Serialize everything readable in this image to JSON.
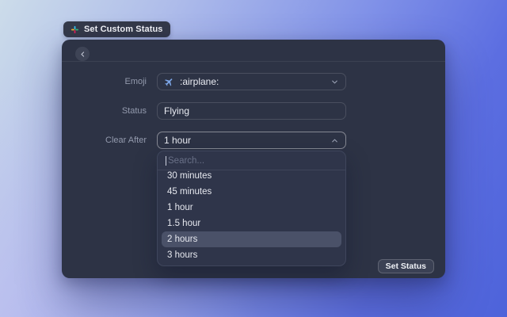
{
  "toast": {
    "label": "Set Custom Status",
    "icon": "slack-icon"
  },
  "window": {
    "header": {
      "back_icon": "chevron-left"
    },
    "form": {
      "emoji_label": "Emoji",
      "emoji_value": ":airplane:",
      "emoji_icon": "airplane-emoji",
      "status_label": "Status",
      "status_value": "Flying",
      "clear_after_label": "Clear After",
      "clear_after_value": "1 hour"
    },
    "dropdown": {
      "search_placeholder": "Search...",
      "options": [
        "30 minutes",
        "45 minutes",
        "1 hour",
        "1.5 hour",
        "2 hours",
        "3 hours"
      ],
      "selected_option": "2 hours"
    },
    "footer": {
      "submit_label": "Set Status"
    }
  },
  "colors": {
    "window_bg": "#2d3345",
    "panel_bg": "#2f354a",
    "selected_row_bg": "#4a5168",
    "accent_plane": "#7da7e9",
    "background_gradient_start": "#ccdcea",
    "background_gradient_end": "#4d63da"
  }
}
